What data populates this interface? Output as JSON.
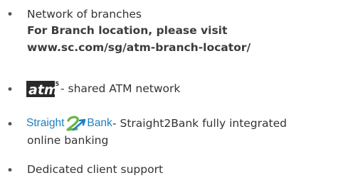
{
  "colors": {
    "text": "#333333",
    "bold_text": "#3c3c3c",
    "brand_blue": "#1b7fc4",
    "brand_green": "#67b446"
  },
  "items": [
    {
      "bullet": "•",
      "text": "Network of branches",
      "bold_line1": "For Branch location, please visit",
      "bold_line2": "www.sc.com/sg/atm-branch-locator/"
    },
    {
      "bullet": "•",
      "logo": "atm5-logo",
      "logo_text": "atm",
      "logo_superscript": "5",
      "text": "- shared ATM network"
    },
    {
      "bullet": "•",
      "logo": "straight2bank-logo",
      "logo_left": "Straight",
      "logo_right": "Bank",
      "text_line1": "- Straight2Bank fully integrated",
      "text_line2": "online banking"
    },
    {
      "bullet": "•",
      "text": "Dedicated client support"
    }
  ]
}
